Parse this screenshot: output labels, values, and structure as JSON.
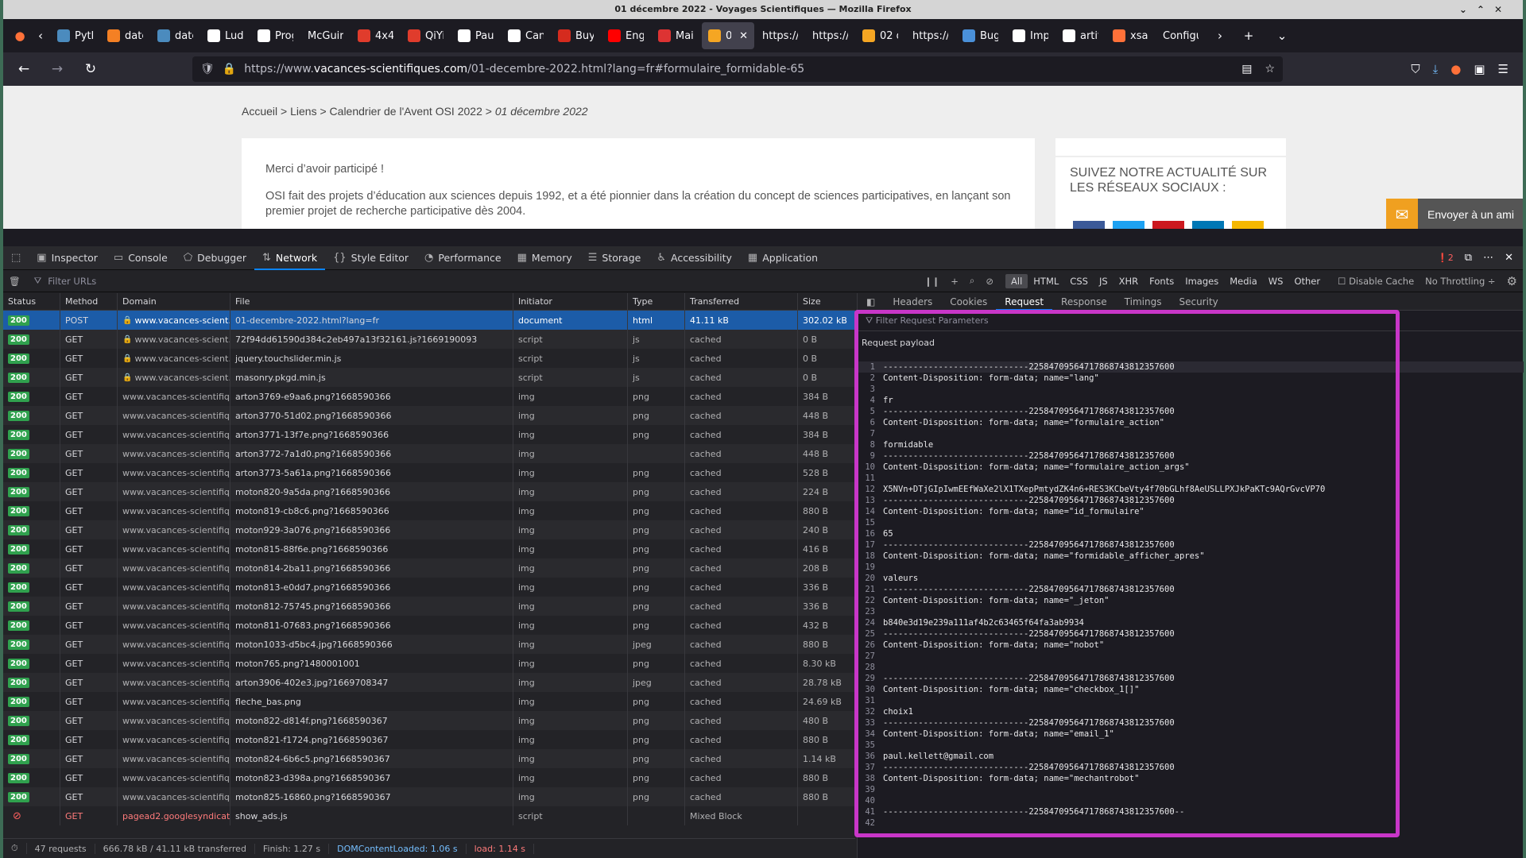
{
  "window": {
    "title": "01 décembre 2022 - Voyages Scientifiques — Mozilla Firefox"
  },
  "tabs": [
    {
      "label": "Pytho",
      "fav": "#4b8bbe",
      "icon": "python-icon"
    },
    {
      "label": "date",
      "fav": "#f48024",
      "icon": "stackoverflow-icon"
    },
    {
      "label": "datet",
      "fav": "#4b8bbe",
      "icon": "python-icon"
    },
    {
      "label": "Lude",
      "fav": "#ffffff",
      "icon": "page-icon"
    },
    {
      "label": "Progr",
      "fav": "#ffffff",
      "icon": "page-icon"
    },
    {
      "label": "McGuire",
      "fav": "",
      "icon": "none"
    },
    {
      "label": "4x4 n",
      "fav": "#e03c2c",
      "icon": "pocket-icon"
    },
    {
      "label": "QiYi",
      "fav": "#e03c2c",
      "icon": "pocket-icon"
    },
    {
      "label": "Pauli",
      "fav": "#ffffff",
      "icon": "wikipedia-icon"
    },
    {
      "label": "Cant",
      "fav": "#ffffff",
      "icon": "wikipedia-icon"
    },
    {
      "label": "Buy F",
      "fav": "#d52b1e",
      "icon": "shop-icon"
    },
    {
      "label": "Engr",
      "fav": "#ff0000",
      "icon": "youtube-icon"
    },
    {
      "label": "Mail",
      "fav": "#d33",
      "icon": "mail-icon"
    },
    {
      "label": "01",
      "fav": "#f5a623",
      "icon": "site-icon",
      "active": true
    },
    {
      "label": "https://w",
      "fav": "",
      "icon": "none"
    },
    {
      "label": "https://w",
      "fav": "",
      "icon": "none"
    },
    {
      "label": "02 de",
      "fav": "#f5a623",
      "icon": "site-icon"
    },
    {
      "label": "https://w",
      "fav": "",
      "icon": "none"
    },
    {
      "label": "Bug",
      "fav": "#4a90d9",
      "icon": "bugzilla-icon"
    },
    {
      "label": "Impo",
      "fav": "#ffffff",
      "icon": "github-icon"
    },
    {
      "label": "artifa",
      "fav": "#ffffff",
      "icon": "github-icon"
    },
    {
      "label": "xsan",
      "fav": "#ff7139",
      "icon": "firefox-icon"
    },
    {
      "label": "Configur",
      "fav": "",
      "icon": "none"
    }
  ],
  "url": {
    "prefix": "https://www.",
    "host": "vacances-scientifiques.com",
    "path": "/01-decembre-2022.html?lang=fr#formulaire_formidable-65"
  },
  "page": {
    "breadcrumb": {
      "home": "Accueil",
      "sep": " > ",
      "links": "Liens",
      "calendar": "Calendrier de l'Avent OSI 2022",
      "current": "01 décembre 2022"
    },
    "thanks": "Merci d’avoir participé !",
    "intro": "OSI fait des projets d’éducation aux sciences depuis 1992, et a été pionnier dans la création du concept de sciences participatives, en lançant son premier projet de recherche participative dès 2004.",
    "follow": "SUIVEZ NOTRE ACTUALITÉ SUR LES RÉSEAUX SOCIAUX :",
    "send": "Envoyer à un ami"
  },
  "devtools": {
    "tabs": [
      "Inspector",
      "Console",
      "Debugger",
      "Network",
      "Style Editor",
      "Performance",
      "Memory",
      "Storage",
      "Accessibility",
      "Application"
    ],
    "error_count": "2",
    "filter_placeholder": "Filter URLs",
    "types": [
      "All",
      "HTML",
      "CSS",
      "JS",
      "XHR",
      "Fonts",
      "Images",
      "Media",
      "WS",
      "Other"
    ],
    "disable_cache": "Disable Cache",
    "throttling": "No Throttling ÷",
    "columns": [
      "Status",
      "Method",
      "Domain",
      "File",
      "Initiator",
      "Type",
      "Transferred",
      "Size"
    ],
    "requests": [
      [
        "200",
        "POST",
        "www.vacances-scient…",
        "01-decembre-2022.html?lang=fr",
        "document",
        "html",
        "41.11 kB",
        "302.02 kB"
      ],
      [
        "200",
        "GET",
        "www.vacances-scient…",
        "72f94dd61590d384c2eb497a13f32161.js?1669190093",
        "script",
        "js",
        "cached",
        "0 B"
      ],
      [
        "200",
        "GET",
        "www.vacances-scient…",
        "jquery.touchslider.min.js",
        "script",
        "js",
        "cached",
        "0 B"
      ],
      [
        "200",
        "GET",
        "www.vacances-scient…",
        "masonry.pkgd.min.js",
        "script",
        "js",
        "cached",
        "0 B"
      ],
      [
        "200",
        "GET",
        "www.vacances-scientifiq…",
        "arton3769-e9aa6.png?1668590366",
        "img",
        "png",
        "cached",
        "384 B"
      ],
      [
        "200",
        "GET",
        "www.vacances-scientifiq…",
        "arton3770-51d02.png?1668590366",
        "img",
        "png",
        "cached",
        "448 B"
      ],
      [
        "200",
        "GET",
        "www.vacances-scientifiq…",
        "arton3771-13f7e.png?1668590366",
        "img",
        "png",
        "cached",
        "384 B"
      ],
      [
        "200",
        "GET",
        "www.vacances-scientifiq…",
        "arton3772-7a1d0.png?1668590366",
        "img",
        "",
        "cached",
        "448 B"
      ],
      [
        "200",
        "GET",
        "www.vacances-scientifiq…",
        "arton3773-5a61a.png?1668590366",
        "img",
        "png",
        "cached",
        "528 B"
      ],
      [
        "200",
        "GET",
        "www.vacances-scientifiq…",
        "moton820-9a5da.png?1668590366",
        "img",
        "png",
        "cached",
        "224 B"
      ],
      [
        "200",
        "GET",
        "www.vacances-scientifiq…",
        "moton819-cb8c6.png?1668590366",
        "img",
        "png",
        "cached",
        "880 B"
      ],
      [
        "200",
        "GET",
        "www.vacances-scientifiq…",
        "moton929-3a076.png?1668590366",
        "img",
        "png",
        "cached",
        "240 B"
      ],
      [
        "200",
        "GET",
        "www.vacances-scientifiq…",
        "moton815-88f6e.png?1668590366",
        "img",
        "png",
        "cached",
        "416 B"
      ],
      [
        "200",
        "GET",
        "www.vacances-scientifiq…",
        "moton814-2ba11.png?1668590366",
        "img",
        "png",
        "cached",
        "208 B"
      ],
      [
        "200",
        "GET",
        "www.vacances-scientifiq…",
        "moton813-e0dd7.png?1668590366",
        "img",
        "png",
        "cached",
        "336 B"
      ],
      [
        "200",
        "GET",
        "www.vacances-scientifiq…",
        "moton812-75745.png?1668590366",
        "img",
        "png",
        "cached",
        "336 B"
      ],
      [
        "200",
        "GET",
        "www.vacances-scientifiq…",
        "moton811-07683.png?1668590366",
        "img",
        "png",
        "cached",
        "432 B"
      ],
      [
        "200",
        "GET",
        "www.vacances-scientifiq…",
        "moton1033-d5bc4.jpg?1668590366",
        "img",
        "jpeg",
        "cached",
        "880 B"
      ],
      [
        "200",
        "GET",
        "www.vacances-scientifiq…",
        "moton765.png?1480001001",
        "img",
        "png",
        "cached",
        "8.30 kB"
      ],
      [
        "200",
        "GET",
        "www.vacances-scientifiq…",
        "arton3906-402e3.jpg?1669708347",
        "img",
        "jpeg",
        "cached",
        "28.78 kB"
      ],
      [
        "200",
        "GET",
        "www.vacances-scientifiq…",
        "fleche_bas.png",
        "img",
        "png",
        "cached",
        "24.69 kB"
      ],
      [
        "200",
        "GET",
        "www.vacances-scientifiq…",
        "moton822-d814f.png?1668590367",
        "img",
        "png",
        "cached",
        "480 B"
      ],
      [
        "200",
        "GET",
        "www.vacances-scientifiq…",
        "moton821-f1724.png?1668590367",
        "img",
        "png",
        "cached",
        "880 B"
      ],
      [
        "200",
        "GET",
        "www.vacances-scientifiq…",
        "moton824-6b6c5.png?1668590367",
        "img",
        "png",
        "cached",
        "1.14 kB"
      ],
      [
        "200",
        "GET",
        "www.vacances-scientifiq…",
        "moton823-d398a.png?1668590367",
        "img",
        "png",
        "cached",
        "880 B"
      ],
      [
        "200",
        "GET",
        "www.vacances-scientifiq…",
        "moton825-16860.png?1668590367",
        "img",
        "png",
        "cached",
        "880 B"
      ],
      [
        "",
        "GET",
        "pagead2.googlesyndicati…",
        "show_ads.js",
        "script",
        "",
        "Mixed Block",
        ""
      ]
    ],
    "status": {
      "requests": "47 requests",
      "size": "666.78 kB / 41.11 kB transferred",
      "finish": "Finish: 1.27 s",
      "dcl": "DOMContentLoaded: 1.06 s",
      "load": "load: 1.14 s"
    },
    "panel_tabs": [
      "Headers",
      "Cookies",
      "Request",
      "Response",
      "Timings",
      "Security"
    ],
    "panel_filter": "Filter Request Parameters",
    "payload_label": "Request payload",
    "payload": [
      "-----------------------------225847095647178687438123576​00",
      "Content-Disposition: form-data; name=\"lang\"",
      "",
      "fr",
      "-----------------------------22584709564717868743812357600",
      "Content-Disposition: form-data; name=\"formulaire_action\"",
      "",
      "formidable",
      "-----------------------------22584709564717868743812357600",
      "Content-Disposition: form-data; name=\"formulaire_action_args\"",
      "",
      "X5NVn+DTjGIpIwmEEfWaXe2lX1TXepPmtydZK4n6+RES3KCbeVty4f70bGLhf8AeUSLLPXJkPaKTc9AQrGvcVP70",
      "-----------------------------22584709564717868743812357600",
      "Content-Disposition: form-data; name=\"id_formulaire\"",
      "",
      "65",
      "-----------------------------22584709564717868743812357600",
      "Content-Disposition: form-data; name=\"formidable_afficher_apres\"",
      "",
      "valeurs",
      "-----------------------------22584709564717868743812357600",
      "Content-Disposition: form-data; name=\"_jeton\"",
      "",
      "b840e3d19e239a111af4b2c63465f64fa3ab9934",
      "-----------------------------22584709564717868743812357600",
      "Content-Disposition: form-data; name=\"nobot\"",
      "",
      "",
      "-----------------------------22584709564717868743812357600",
      "Content-Disposition: form-data; name=\"checkbox_1[]\"",
      "",
      "choix1",
      "-----------------------------22584709564717868743812357600",
      "Content-Disposition: form-data; name=\"email_1\"",
      "",
      "paul.kellett@gmail.com",
      "-----------------------------22584709564717868743812357600",
      "Content-Disposition: form-data; name=\"mechantrobot\"",
      "",
      "",
      "-----------------------------22584709564717868743812357600--",
      ""
    ]
  }
}
